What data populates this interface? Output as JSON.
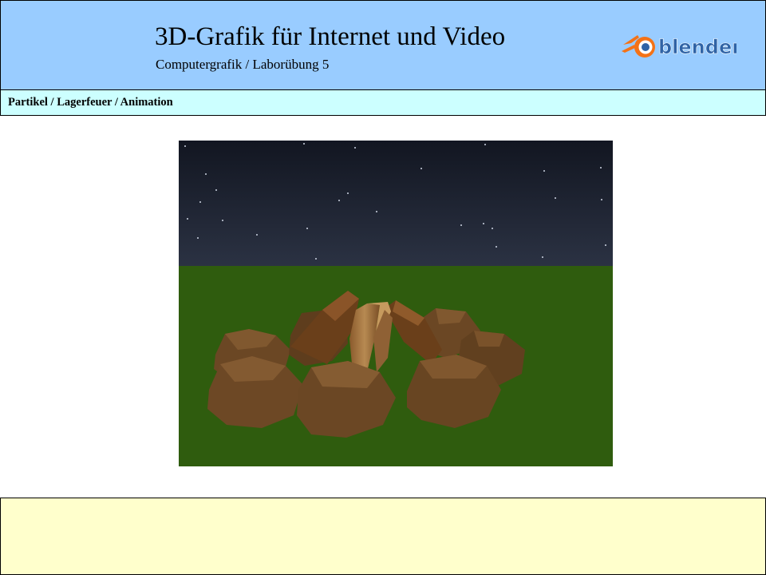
{
  "header": {
    "title": "3D-Grafik für Internet und Video",
    "subtitle": "Computergrafik / Laborübung 5",
    "logo_text": "blender",
    "logo_icon": "blender-logo-icon"
  },
  "breadcrumb": {
    "text": "Partikel / Lagerfeuer / Animation"
  },
  "render": {
    "icon": "campfire-render-image",
    "colors": {
      "sky_top": "#121621",
      "sky_bottom": "#2b3243",
      "ground": "#2f5c0e",
      "stone": "#6b4724",
      "wood": "#a0713f"
    }
  },
  "notes": {
    "text": ""
  }
}
